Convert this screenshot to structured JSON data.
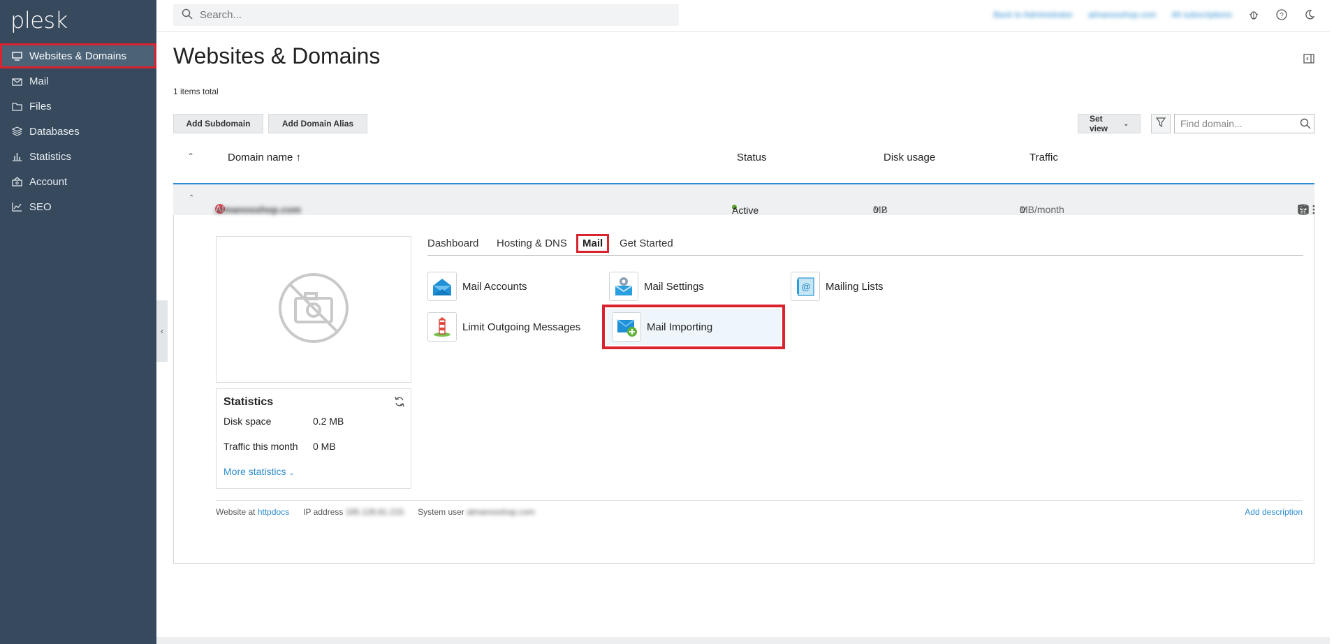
{
  "app": {
    "logo": "plesk"
  },
  "sidebar": {
    "items": [
      {
        "label": "Websites & Domains",
        "icon": "monitor-icon"
      },
      {
        "label": "Mail",
        "icon": "envelope-icon"
      },
      {
        "label": "Files",
        "icon": "folder-icon"
      },
      {
        "label": "Databases",
        "icon": "database-icon"
      },
      {
        "label": "Statistics",
        "icon": "bar-chart-icon"
      },
      {
        "label": "Account",
        "icon": "account-icon"
      },
      {
        "label": "SEO",
        "icon": "line-chart-icon"
      }
    ]
  },
  "topbar": {
    "search_placeholder": "Search...",
    "back_link": "Back to Administrator",
    "user": "almanosshop.com",
    "subscriptions": "All subscriptions"
  },
  "page": {
    "title": "Websites & Domains",
    "count": "1 items total",
    "add_subdomain": "Add Subdomain",
    "add_alias": "Add Domain Alias",
    "set_view": "Set view",
    "find_placeholder": "Find domain..."
  },
  "table": {
    "headers": {
      "domain": "Domain name ↑",
      "status": "Status",
      "disk": "Disk usage",
      "traffic": "Traffic"
    },
    "row": {
      "domain": "almanosshop.com",
      "avatar": "AL",
      "status": "Active",
      "disk_value": "0.2",
      "disk_unit": "MB",
      "traffic_value": "0",
      "traffic_unit": "MB/month"
    }
  },
  "tabs": [
    "Dashboard",
    "Hosting & DNS",
    "Mail",
    "Get Started"
  ],
  "tools": [
    {
      "label": "Mail Accounts",
      "icon": "mail-accounts-icon"
    },
    {
      "label": "Mail Settings",
      "icon": "mail-settings-icon"
    },
    {
      "label": "Mailing Lists",
      "icon": "mailing-lists-icon"
    },
    {
      "label": "Limit Outgoing Messages",
      "icon": "limit-outgoing-icon"
    },
    {
      "label": "Mail Importing",
      "icon": "mail-importing-icon"
    }
  ],
  "statistics": {
    "title": "Statistics",
    "disk_label": "Disk space",
    "disk_value": "0.2 MB",
    "traffic_label": "Traffic this month",
    "traffic_value": "0 MB",
    "more": "More statistics"
  },
  "footer": {
    "website_at": "Website at",
    "httpdocs": "httpdocs",
    "ip_label": "IP address",
    "ip_value": "185.128.81.215",
    "sysuser_label": "System user",
    "sysuser_value": "almanosshop.com",
    "add_description": "Add description"
  },
  "colors": {
    "sidebar": "#37495c",
    "accent": "#2d8cd0",
    "highlight": "#d9232f",
    "active_status": "#5fa32f"
  }
}
